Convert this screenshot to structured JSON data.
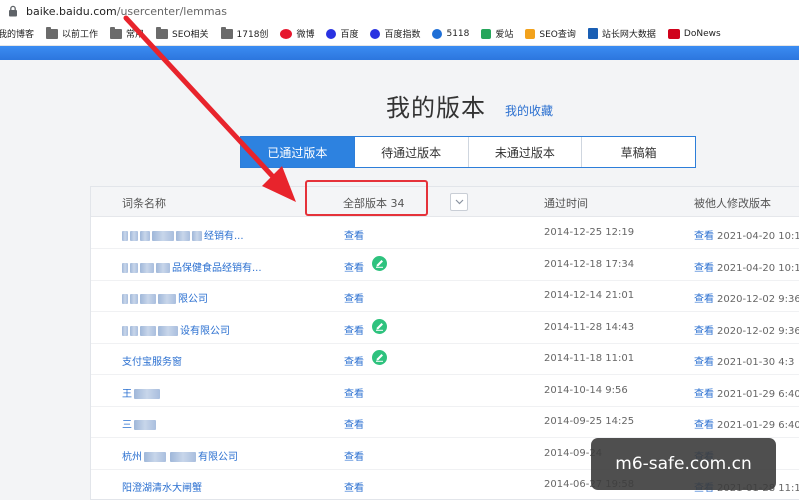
{
  "address": {
    "host": "baike.baidu.com",
    "path": "/usercenter/lemmas"
  },
  "bookmarks": [
    {
      "label": "我的博客",
      "icon": "none"
    },
    {
      "label": "以前工作",
      "icon": "folder-icon"
    },
    {
      "label": "常用",
      "icon": "folder-icon"
    },
    {
      "label": "SEO相关",
      "icon": "folder-icon"
    },
    {
      "label": "1718创",
      "icon": "folder-icon"
    },
    {
      "label": "微博",
      "icon": "weibo-icon"
    },
    {
      "label": "百度",
      "icon": "baidu-paw-icon"
    },
    {
      "label": "百度指数",
      "icon": "baidu-paw-icon"
    },
    {
      "label": "5118",
      "icon": "5118-icon"
    },
    {
      "label": "爱站",
      "icon": "aizhan-icon"
    },
    {
      "label": "SEO查询",
      "icon": "seo-query-icon"
    },
    {
      "label": "站长网大数据",
      "icon": "chinaz-icon"
    },
    {
      "label": "DoNews",
      "icon": "donews-icon"
    }
  ],
  "page": {
    "title": "我的版本",
    "favorites_link": "我的收藏"
  },
  "tabs": [
    "已通过版本",
    "待通过版本",
    "未通过版本",
    "草稿箱"
  ],
  "table": {
    "headers": {
      "name": "词条名称",
      "versions": "全部版本 34",
      "pass_time": "通过时间",
      "modified": "被他人修改版本"
    },
    "rows": [
      {
        "name": "经销有...",
        "view": "查看",
        "edit": false,
        "date": "2014-12-25 12:19",
        "mod_link": "查看",
        "mod_date": "2021-04-20 10:1"
      },
      {
        "name": "品保健食品经销有...",
        "view": "查看",
        "edit": true,
        "date": "2014-12-18 17:34",
        "mod_link": "查看",
        "mod_date": "2021-04-20 10:1"
      },
      {
        "name": "限公司",
        "view": "查看",
        "edit": false,
        "date": "2014-12-14 21:01",
        "mod_link": "查看",
        "mod_date": "2020-12-02 9:36"
      },
      {
        "name": "设有限公司",
        "view": "查看",
        "edit": true,
        "date": "2014-11-28 14:43",
        "mod_link": "查看",
        "mod_date": "2020-12-02 9:36"
      },
      {
        "name": "支付宝服务窗",
        "view": "查看",
        "edit": true,
        "date": "2014-11-18 11:01",
        "mod_link": "查看",
        "mod_date": "2021-01-30 4:3"
      },
      {
        "name": "王",
        "view": "查看",
        "edit": false,
        "date": "2014-10-14 9:56",
        "mod_link": "查看",
        "mod_date": "2021-01-29 6:40"
      },
      {
        "name": "三",
        "view": "查看",
        "edit": false,
        "date": "2014-09-25 14:25",
        "mod_link": "查看",
        "mod_date": "2021-01-29 6:40"
      },
      {
        "name": "杭州",
        "name_tail": "有限公司",
        "view": "查看",
        "edit": false,
        "date": "2014-09-24",
        "mod_link": "查看",
        "mod_date": ""
      },
      {
        "name": "阳澄湖清水大闸蟹",
        "view": "查看",
        "edit": false,
        "date": "2014-06-27 19:58",
        "mod_link": "查看",
        "mod_date": "2021-01-28 11:1"
      }
    ]
  },
  "watermark": "m6-safe.com.cn",
  "colors": {
    "accent": "#2d82e0",
    "link": "#2a6fd0",
    "highlight": "#e5323a",
    "edit_badge": "#2ec27e"
  }
}
